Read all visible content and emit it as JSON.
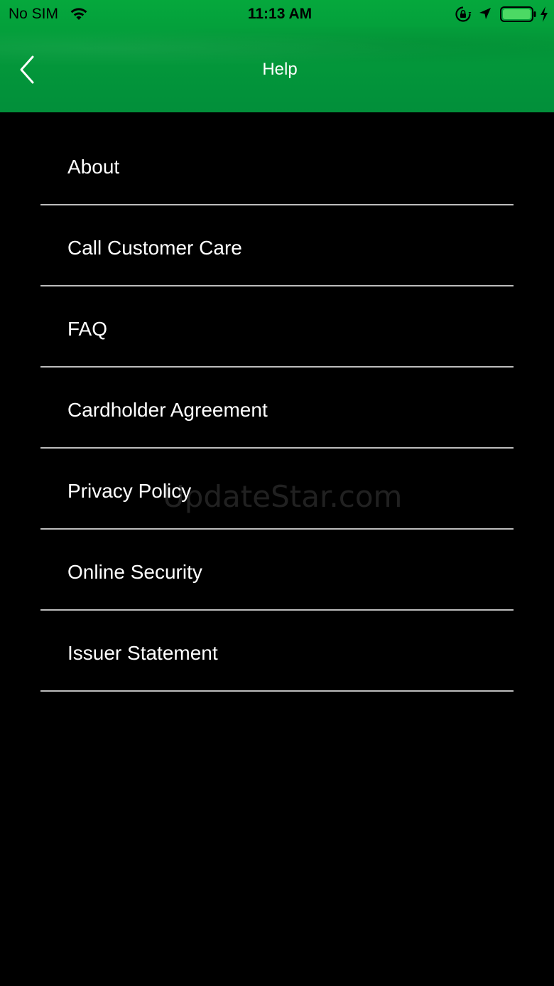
{
  "status_bar": {
    "carrier": "No SIM",
    "time": "11:13 AM",
    "battery_color": "#4cd964",
    "icons": [
      "wifi-icon",
      "lock-rotation-icon",
      "location-arrow-icon",
      "battery-icon",
      "charging-bolt-icon"
    ]
  },
  "header": {
    "title": "Help",
    "background_color": "#03983a",
    "back_icon": "chevron-left-icon"
  },
  "menu": {
    "items": [
      {
        "label": "About"
      },
      {
        "label": "Call Customer Care"
      },
      {
        "label": "FAQ"
      },
      {
        "label": "Cardholder Agreement"
      },
      {
        "label": "Privacy Policy"
      },
      {
        "label": "Online Security"
      },
      {
        "label": "Issuer Statement"
      }
    ]
  },
  "watermark": {
    "text": "UpdateStar.com"
  }
}
